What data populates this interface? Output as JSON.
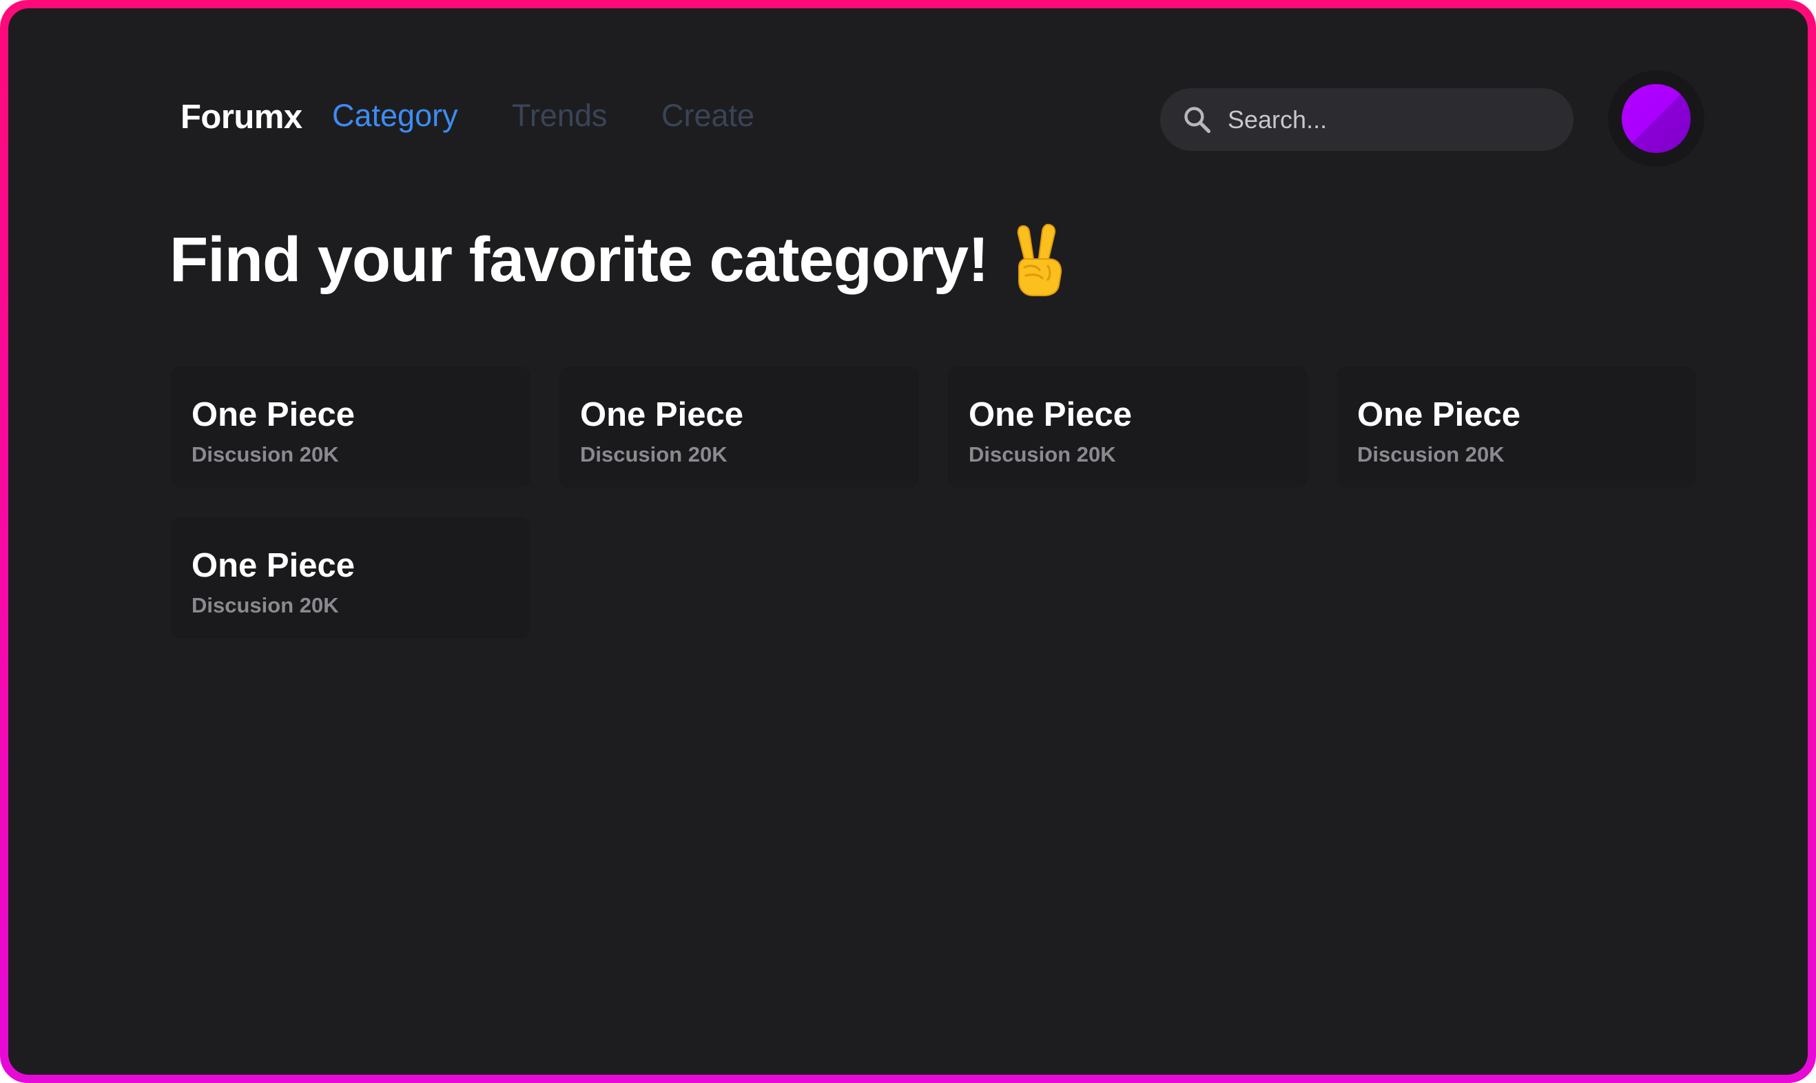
{
  "nav": {
    "brand": "Forumx",
    "links": [
      {
        "label": "Category",
        "active": true
      },
      {
        "label": "Trends",
        "active": false
      },
      {
        "label": "Create",
        "active": false
      }
    ],
    "search": {
      "placeholder": "Search...",
      "value": "",
      "icon": "search-icon"
    },
    "avatar": {
      "icon": "avatar"
    }
  },
  "main": {
    "heading": "Find your favorite category!",
    "heading_emoji": "victory-hand-emoji",
    "cards": [
      {
        "title": "One Piece",
        "subtitle": "Discusion 20K"
      },
      {
        "title": "One Piece",
        "subtitle": "Discusion 20K"
      },
      {
        "title": "One Piece",
        "subtitle": "Discusion 20K"
      },
      {
        "title": "One Piece",
        "subtitle": "Discusion 20K"
      },
      {
        "title": "One Piece",
        "subtitle": "Discusion 20K"
      }
    ]
  },
  "colors": {
    "background": "#1d1d20",
    "card": "#1a1a1c",
    "accent": "#3d8cf2",
    "inactive_link": "#3a4456",
    "avatar": "#a900ff",
    "frame_border": "#ff0a78"
  }
}
